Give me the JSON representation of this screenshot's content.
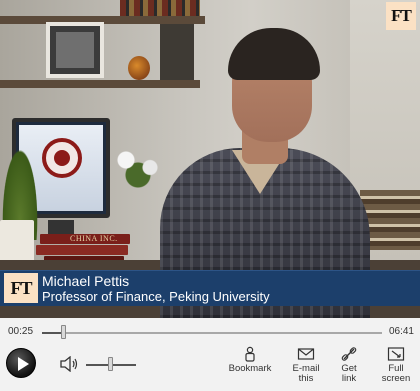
{
  "video": {
    "logo_text": "FT",
    "book_label": "CHINA INC.",
    "lower_third": {
      "logo_text": "FT",
      "name": "Michael Pettis",
      "title": "Professor of Finance, Peking University"
    }
  },
  "player": {
    "current_time": "00:25",
    "total_time": "06:41",
    "progress": 0.062,
    "volume": 0.48,
    "controls": {
      "bookmark": "Bookmark",
      "email": "E-mail\nthis",
      "get_link": "Get\nlink",
      "full_screen": "Full\nscreen"
    }
  },
  "colors": {
    "lower_third_bg": "#1c3f6b",
    "ft_logo_bg": "#fbe1c4",
    "control_bar_bg": "#f2f2f2"
  },
  "icons": [
    "play-icon",
    "speaker-icon",
    "bookmark-icon",
    "envelope-icon",
    "link-icon",
    "full-screen-icon"
  ]
}
